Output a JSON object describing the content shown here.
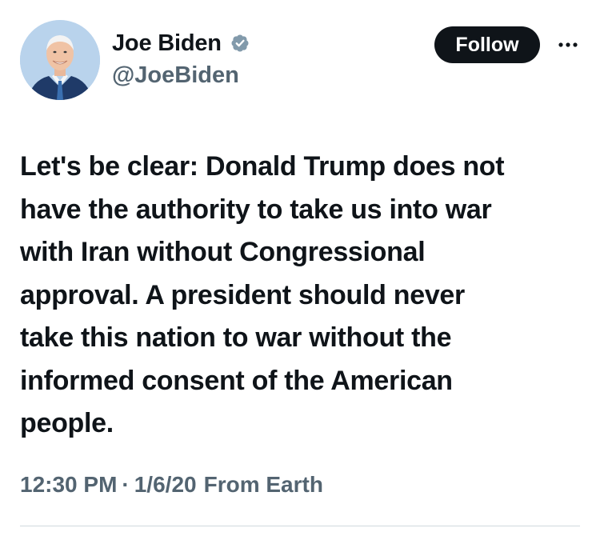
{
  "user": {
    "display_name": "Joe Biden",
    "handle": "@JoeBiden",
    "verified_badge_color": "#829aab"
  },
  "actions": {
    "follow_label": "Follow",
    "more_icon": "more-horizontal-icon"
  },
  "tweet": {
    "lines": [
      "Let's be clear: Donald Trump does not",
      "have the authority to take us into war",
      "with Iran without Congressional",
      "approval. A president should never",
      "take this nation to war without the",
      "informed consent of the American",
      "people."
    ]
  },
  "meta": {
    "time": "12:30 PM",
    "separator": "·",
    "date": "1/6/20",
    "source": "From Earth"
  },
  "colors": {
    "text_primary": "#0f1419",
    "text_secondary": "#536471",
    "button_bg": "#0f1419",
    "button_text": "#ffffff",
    "divider": "#cfd9de"
  }
}
